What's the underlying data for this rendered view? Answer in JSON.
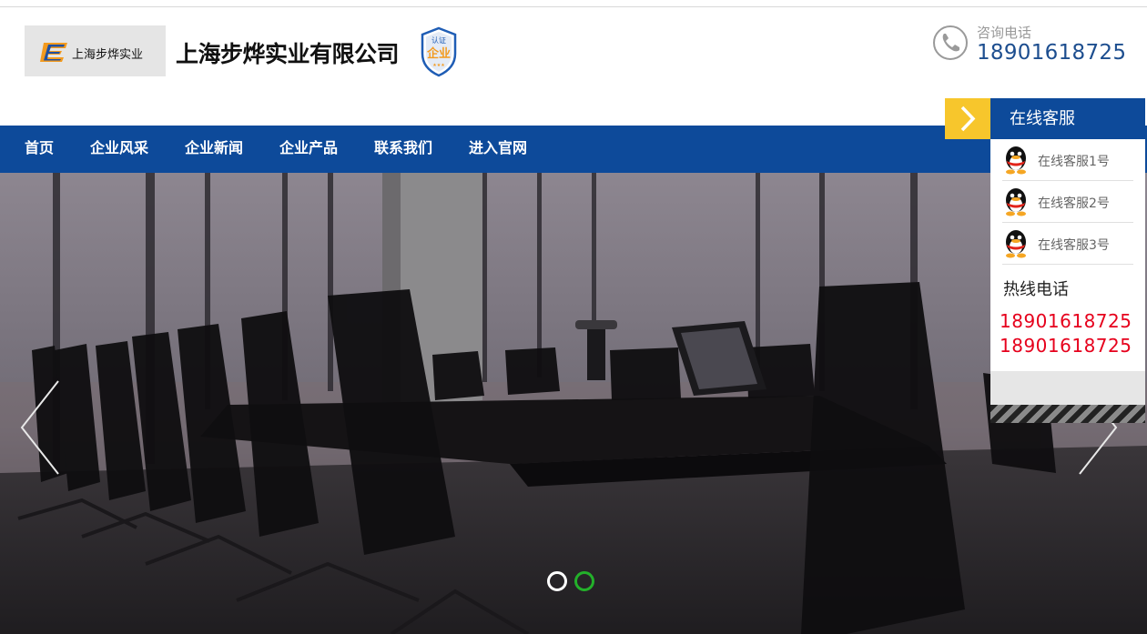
{
  "header": {
    "logo_text": "上海步烨实业",
    "company_name": "上海步烨实业有限公司",
    "badge_top": "认证",
    "badge_main": "企业",
    "consult_label": "咨询电话",
    "phone": "18901618725"
  },
  "nav": {
    "items": [
      {
        "label": "首页"
      },
      {
        "label": "企业风采"
      },
      {
        "label": "企业新闻"
      },
      {
        "label": "企业产品"
      },
      {
        "label": "联系我们"
      },
      {
        "label": "进入官网"
      }
    ]
  },
  "carousel": {
    "slide_count": 2,
    "active_index": 1
  },
  "customer_service": {
    "title": "在线客服",
    "agents": [
      {
        "label": "在线客服1号"
      },
      {
        "label": "在线客服2号"
      },
      {
        "label": "在线客服3号"
      }
    ],
    "hotline_label": "热线电话",
    "hotlines": [
      "18901618725",
      "18901618725"
    ]
  },
  "colors": {
    "nav_bg": "#0d4a9a",
    "accent_yellow": "#f7c62c",
    "hotline_red": "#e6001c",
    "phone_blue": "#1d4e8f"
  },
  "icons": {
    "phone": "phone-icon",
    "qq": "qq-penguin-icon",
    "prev": "chevron-left-icon",
    "next": "chevron-right-icon",
    "toggle": "chevron-right-icon"
  }
}
